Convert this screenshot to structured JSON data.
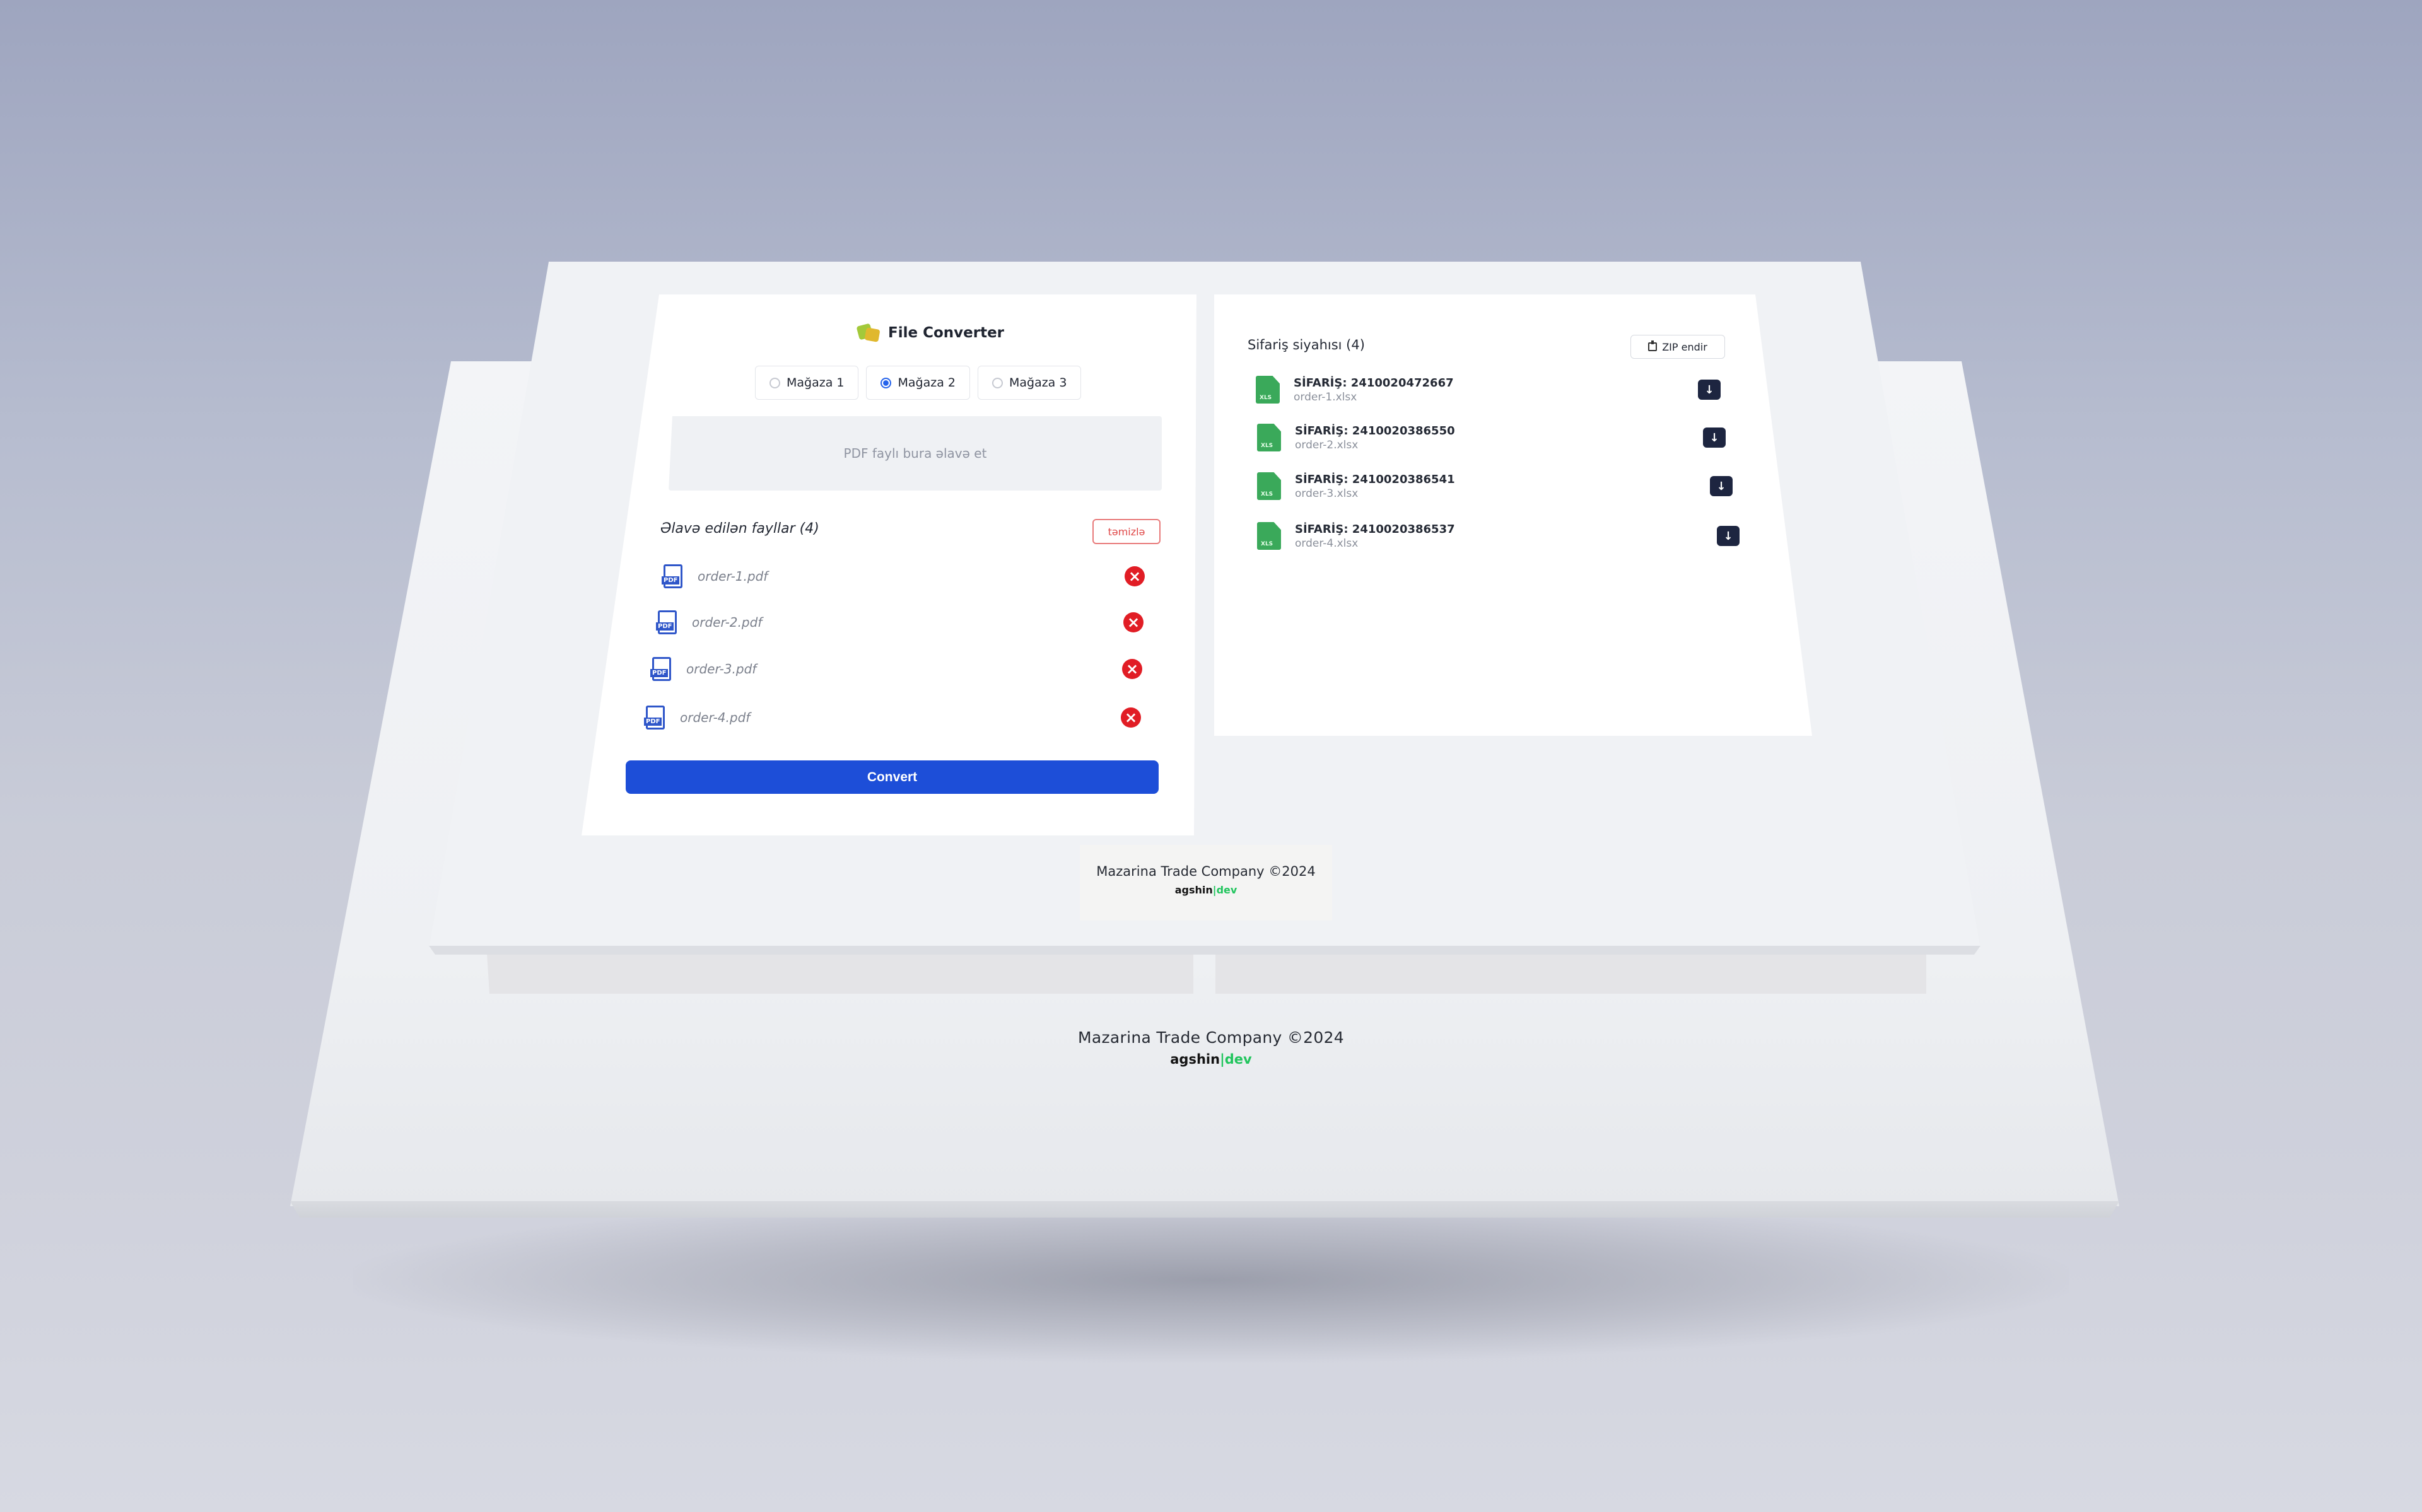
{
  "app": {
    "title": "File Converter"
  },
  "stores": {
    "options": [
      "Mağaza 1",
      "Mağaza 2",
      "Mağaza 3"
    ],
    "selected": "Mağaza 2"
  },
  "upload": {
    "dropzone_text": "PDF faylı bura əlavə et"
  },
  "added_files": {
    "title": "Əlavə edilən fayllar (4)",
    "clear_label": "təmizlə",
    "files": [
      "order-1.pdf",
      "order-2.pdf",
      "order-3.pdf",
      "order-4.pdf"
    ],
    "file_icon_text": "PDF"
  },
  "convert": {
    "label": "Convert"
  },
  "orders": {
    "title": "Sifariş siyahısı (4)",
    "zip_label": "ZIP endir",
    "file_icon_text": "XLS",
    "items": [
      {
        "title": "SİFARİŞ: 2410020472667",
        "file": "order-1.xlsx"
      },
      {
        "title": "SİFARİŞ: 2410020386550",
        "file": "order-2.xlsx"
      },
      {
        "title": "SİFARİŞ: 2410020386541",
        "file": "order-3.xlsx"
      },
      {
        "title": "SİFARİŞ: 2410020386537",
        "file": "order-4.xlsx"
      }
    ]
  },
  "footer": {
    "company": "Mazarina Trade Company ©2024",
    "brand_main": "agshin",
    "brand_sep": "|",
    "brand_accent": "dev"
  },
  "colors": {
    "primary": "#1d4ed8",
    "danger": "#e11d25",
    "excel": "#3aa95a",
    "brand_accent": "#22c55e"
  }
}
